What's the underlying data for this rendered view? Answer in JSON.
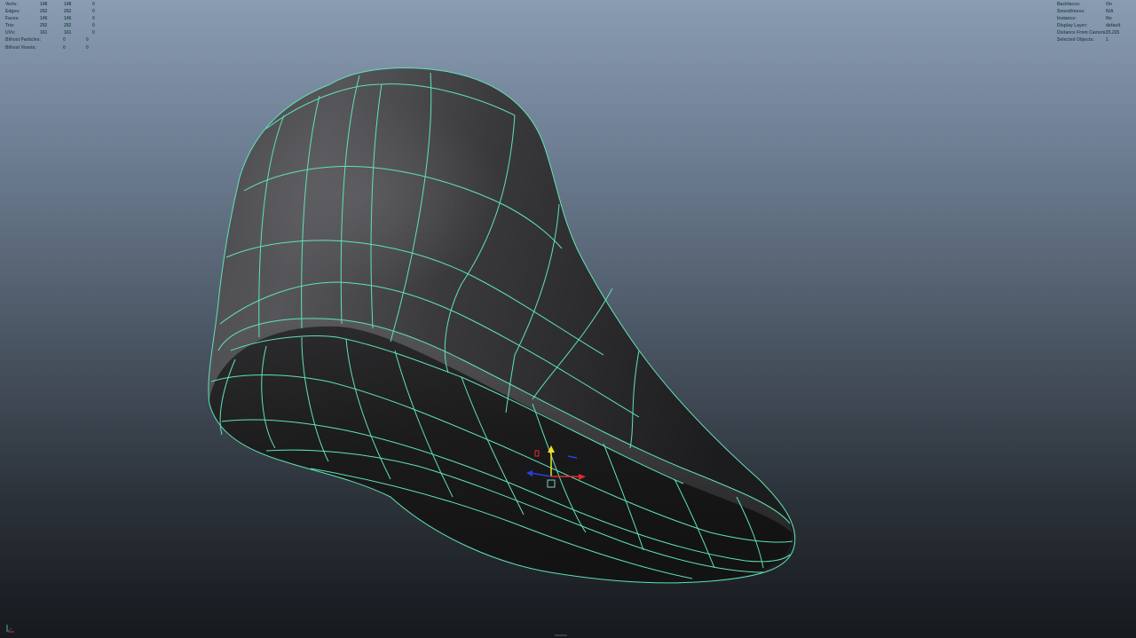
{
  "hud_left": {
    "rows": [
      {
        "label": "Verts:",
        "v1": "148",
        "v2": "148",
        "v3": "0"
      },
      {
        "label": "Edges:",
        "v1": "292",
        "v2": "292",
        "v3": "0"
      },
      {
        "label": "Faces:",
        "v1": "146",
        "v2": "146",
        "v3": "0"
      },
      {
        "label": "Tris:",
        "v1": "292",
        "v2": "292",
        "v3": "0"
      },
      {
        "label": "UVs:",
        "v1": "161",
        "v2": "161",
        "v3": "0"
      }
    ],
    "particle_rows": [
      {
        "label": "Bifrost Particles:",
        "v1": "0",
        "v2": "0"
      },
      {
        "label": "Bifrost Voxels:",
        "v1": "0",
        "v2": "0"
      }
    ]
  },
  "hud_right": {
    "rows": [
      {
        "label": "Backfaces:",
        "value": "On"
      },
      {
        "label": "Smoothness:",
        "value": "N/A"
      },
      {
        "label": "Instance:",
        "value": "No"
      },
      {
        "label": "Display Layer:",
        "value": "default"
      },
      {
        "label": "Distance From Camera:",
        "value": "25.225"
      },
      {
        "label": "Selected Objects:",
        "value": "1"
      }
    ]
  },
  "manipulator": {
    "axis_colors": {
      "x": "#e52a2a",
      "y": "#f2e022",
      "z": "#2a3fe0"
    },
    "center_color": "#7ad0c2"
  },
  "wireframe_color": "#5fe3b4",
  "viewport_gradient": {
    "top": "#8a9cb2",
    "bottom": "#16191d"
  }
}
